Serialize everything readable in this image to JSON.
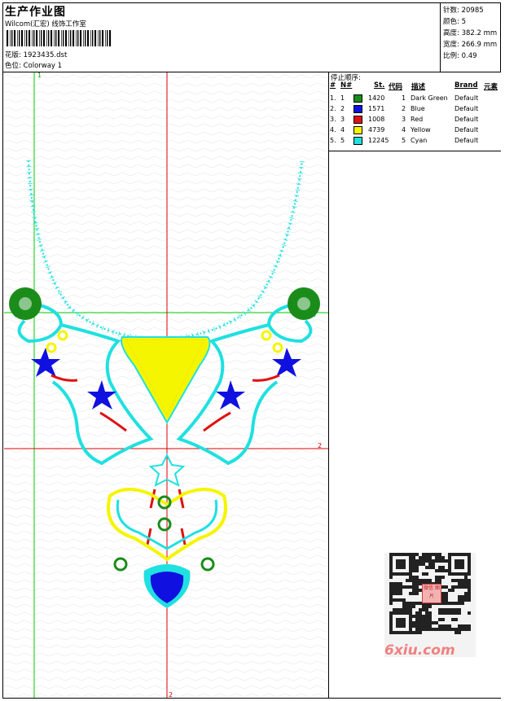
{
  "header": {
    "title": "生产作业图",
    "company": "Wilcom(汇宏) 线饰工作室",
    "design_label": "花版: 1923435.dst",
    "colorway_label": "色位: Colorway 1"
  },
  "stats": [
    {
      "label": "针数",
      "value": "20985"
    },
    {
      "label": "颜色",
      "value": "5"
    },
    {
      "label": "高度",
      "value": "382.2 mm"
    },
    {
      "label": "宽度",
      "value": "266.9 mm"
    },
    {
      "label": "比例",
      "value": "0.49"
    }
  ],
  "stop_sequence": {
    "title": "停止顺序:",
    "headers": [
      "#",
      "N#",
      "St.",
      "代码",
      "描述",
      "Brand",
      "元素"
    ],
    "rows": [
      {
        "idx": "1.",
        "n": "1",
        "color": "#1a8c1a",
        "st": "1420",
        "code": "1",
        "desc": "Dark Green",
        "brand": "Default"
      },
      {
        "idx": "2.",
        "n": "2",
        "color": "#1010e0",
        "st": "1571",
        "code": "2",
        "desc": "Blue",
        "brand": "Default"
      },
      {
        "idx": "3.",
        "n": "3",
        "color": "#e01010",
        "st": "1008",
        "code": "3",
        "desc": "Red",
        "brand": "Default"
      },
      {
        "idx": "4.",
        "n": "4",
        "color": "#f5f500",
        "st": "4739",
        "code": "4",
        "desc": "Yellow",
        "brand": "Default"
      },
      {
        "idx": "5.",
        "n": "5",
        "color": "#20e0e0",
        "st": "12245",
        "code": "5",
        "desc": "Cyan",
        "brand": "Default"
      }
    ]
  },
  "canvas": {
    "marker_top": "1",
    "marker_right": "2",
    "marker_bottom": "2"
  },
  "watermark": {
    "text": "6xiu.com",
    "seal": "微信 图片"
  },
  "colors": {
    "dark_green": "#1a8c1a",
    "blue": "#1010e0",
    "red": "#e01010",
    "yellow": "#f5f500",
    "cyan": "#20e0e0",
    "guide_green": "#00cc00",
    "guide_red": "#dd0000"
  }
}
